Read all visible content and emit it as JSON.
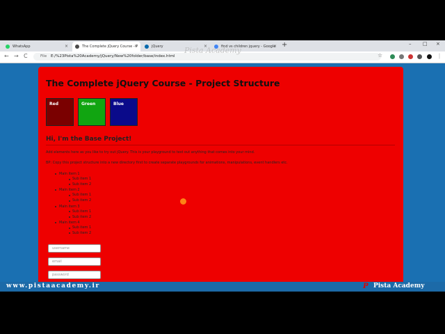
{
  "browser": {
    "tabs": [
      {
        "title": "WhatsApp",
        "icon": "whatsapp-icon",
        "color": "#25d366"
      },
      {
        "title": "The Complete jQuery Course - P",
        "icon": "page-icon",
        "color": "#4a4a4a"
      },
      {
        "title": "jQuery",
        "icon": "jquery-icon",
        "color": "#0769ad"
      },
      {
        "title": "find vs children jquery - Google",
        "icon": "google-icon",
        "color": "#4285f4"
      }
    ],
    "new_tab": "+",
    "window_controls": [
      "–",
      "□",
      "×"
    ],
    "nav": {
      "back": "←",
      "forward": "→",
      "reload": "C"
    },
    "address_prefix": "File",
    "address": "E:/%23Pista%20Academy/jQuery/New%20folder/base/index.html",
    "star": "☆"
  },
  "watermark": "Pista Academy",
  "page": {
    "title": "The Complete jQuery Course - Project Structure",
    "boxes": [
      {
        "label": "Red",
        "color": "#7a0000"
      },
      {
        "label": "Green",
        "color": "#11a511"
      },
      {
        "label": "Blue",
        "color": "#0a0a8a"
      }
    ],
    "subtitle": "Hi, I'm the Base Project!",
    "paragraph1": "Add elements here as you like to try out jQuery. This is your playground to test out anything that comes into your mind.",
    "paragraph2": "BP: Copy this project structure into a new directory first to create separate playgrounds for animations, manipulations, event handlers etc.",
    "list": [
      {
        "label": "Main item 1",
        "sub": [
          "Sub item 1",
          "Sub item 2"
        ]
      },
      {
        "label": "Main item 2",
        "sub": [
          "Sub item 1",
          "Sub item 2"
        ]
      },
      {
        "label": "Main item 3",
        "sub": [
          "Sub item 1",
          "Sub item 2"
        ]
      },
      {
        "label": "Main item 4",
        "sub": [
          "Sub item 1",
          "Sub item 2"
        ]
      }
    ],
    "form": {
      "username_placeholder": "username",
      "email_placeholder": "email",
      "password_placeholder": "password"
    }
  },
  "footer": {
    "site": "www.pistaacademy.ir",
    "brand": "Pista Academy",
    "logo": "P"
  }
}
